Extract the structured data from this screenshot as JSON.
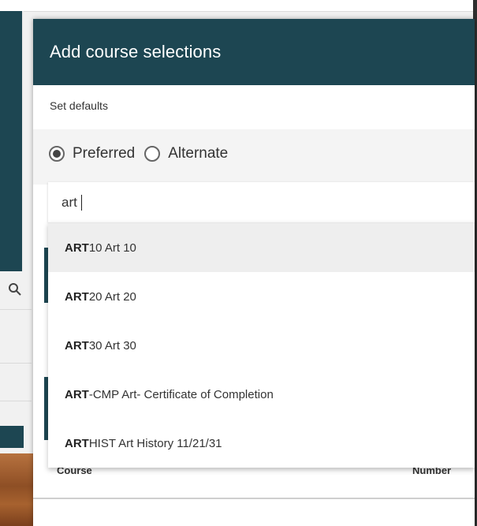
{
  "modal": {
    "title": "Add course selections",
    "set_defaults": "Set defaults",
    "radio": {
      "preferred": "Preferred",
      "alternate": "Alternate",
      "selected": "preferred"
    }
  },
  "search": {
    "value": "art"
  },
  "dropdown": {
    "highlighted_index": 0,
    "options": [
      {
        "match": "ART",
        "rest": "10 Art 10"
      },
      {
        "match": "ART",
        "rest": "20 Art 20"
      },
      {
        "match": "ART",
        "rest": "30 Art 30"
      },
      {
        "match": "ART",
        "rest": "-CMP Art- Certificate of Completion"
      },
      {
        "match": "ART",
        "rest": "HIST Art History 11/21/31"
      }
    ]
  },
  "table": {
    "columns": [
      "Course",
      "Number"
    ]
  },
  "colors": {
    "header_dark": "#1d4652",
    "highlight": "#eeeeee"
  }
}
